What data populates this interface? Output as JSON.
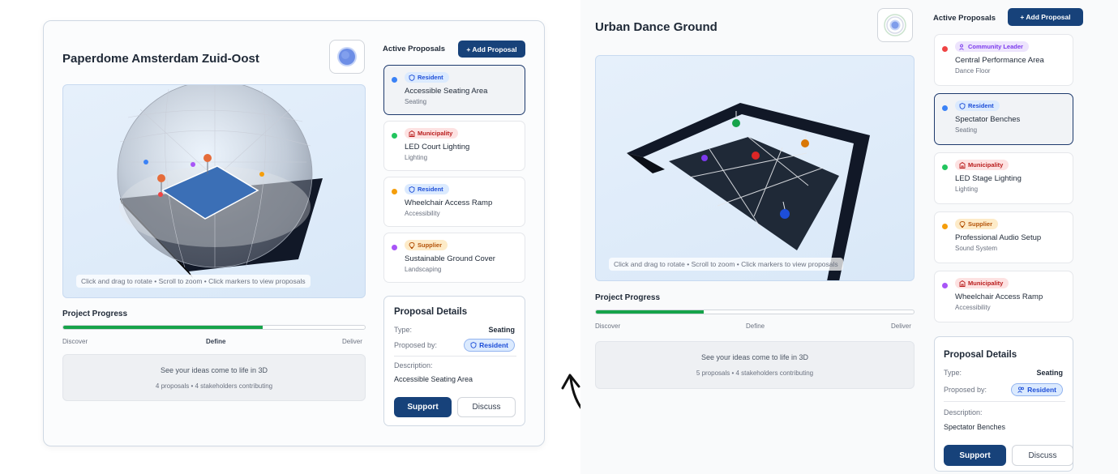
{
  "left": {
    "title": "Paperdome Amsterdam Zuid-Oost",
    "hint": "Click and drag to rotate • Scroll to zoom • Click markers to view proposals",
    "progress": {
      "title": "Project Progress",
      "value_percent": 66,
      "stages": [
        "Discover",
        "Define",
        "Deliver"
      ],
      "active_stage": "Define"
    },
    "info": {
      "main": "See your ideas come to life in 3D",
      "sub": "4 proposals • 4 stakeholders contributing"
    },
    "proposals_label": "Active Proposals",
    "add_label": "+ Add Proposal",
    "proposals": [
      {
        "role": "Resident",
        "role_type": "resident",
        "title": "Accessible Seating Area",
        "category": "Seating",
        "color": "#3b82f6",
        "selected": true
      },
      {
        "role": "Municipality",
        "role_type": "municipality",
        "title": "LED Court Lighting",
        "category": "Lighting",
        "color": "#22c55e",
        "selected": false
      },
      {
        "role": "Resident",
        "role_type": "resident",
        "title": "Wheelchair Access Ramp",
        "category": "Accessibility",
        "color": "#f59e0b",
        "selected": false
      },
      {
        "role": "Supplier",
        "role_type": "supplier",
        "title": "Sustainable Ground Cover",
        "category": "Landscaping",
        "color": "#a855f7",
        "selected": false
      }
    ],
    "details": {
      "title": "Proposal Details",
      "type_label": "Type:",
      "type_value": "Seating",
      "by_label": "Proposed by:",
      "by_value": "Resident",
      "desc_label": "Description:",
      "desc_value": "Accessible Seating Area",
      "support": "Support",
      "discuss": "Discuss"
    }
  },
  "right": {
    "title": "Urban Dance Ground",
    "hint": "Click and drag to rotate • Scroll to zoom • Click markers to view proposals",
    "progress": {
      "title": "Project Progress",
      "value_percent": 34,
      "stages": [
        "Discover",
        "Define",
        "Deliver"
      ],
      "active_stage": ""
    },
    "info": {
      "main": "See your ideas come to life in 3D",
      "sub": "5 proposals • 4 stakeholders contributing"
    },
    "proposals_label": "Active Proposals",
    "add_label": "+ Add Proposal",
    "proposals": [
      {
        "role": "Community Leader",
        "role_type": "community",
        "title": "Central Performance Area",
        "category": "Dance Floor",
        "color": "#ef4444",
        "selected": false
      },
      {
        "role": "Resident",
        "role_type": "resident",
        "title": "Spectator Benches",
        "category": "Seating",
        "color": "#3b82f6",
        "selected": true
      },
      {
        "role": "Municipality",
        "role_type": "municipality",
        "title": "LED Stage Lighting",
        "category": "Lighting",
        "color": "#22c55e",
        "selected": false
      },
      {
        "role": "Supplier",
        "role_type": "supplier",
        "title": "Professional Audio Setup",
        "category": "Sound System",
        "color": "#f59e0b",
        "selected": false
      },
      {
        "role": "Municipality",
        "role_type": "municipality",
        "title": "Wheelchair Access Ramp",
        "category": "Accessibility",
        "color": "#a855f7",
        "selected": false
      }
    ],
    "details": {
      "title": "Proposal Details",
      "type_label": "Type:",
      "type_value": "Seating",
      "by_label": "Proposed by:",
      "by_value": "Resident",
      "desc_label": "Description:",
      "desc_value": "Spectator Benches",
      "support": "Support",
      "discuss": "Discuss"
    }
  },
  "colors": {
    "primary": "#17427a",
    "progress": "#16a34a",
    "resident": "#3b82f6",
    "municipality": "#ef4444",
    "supplier": "#f59e0b",
    "community": "#a855f7"
  }
}
